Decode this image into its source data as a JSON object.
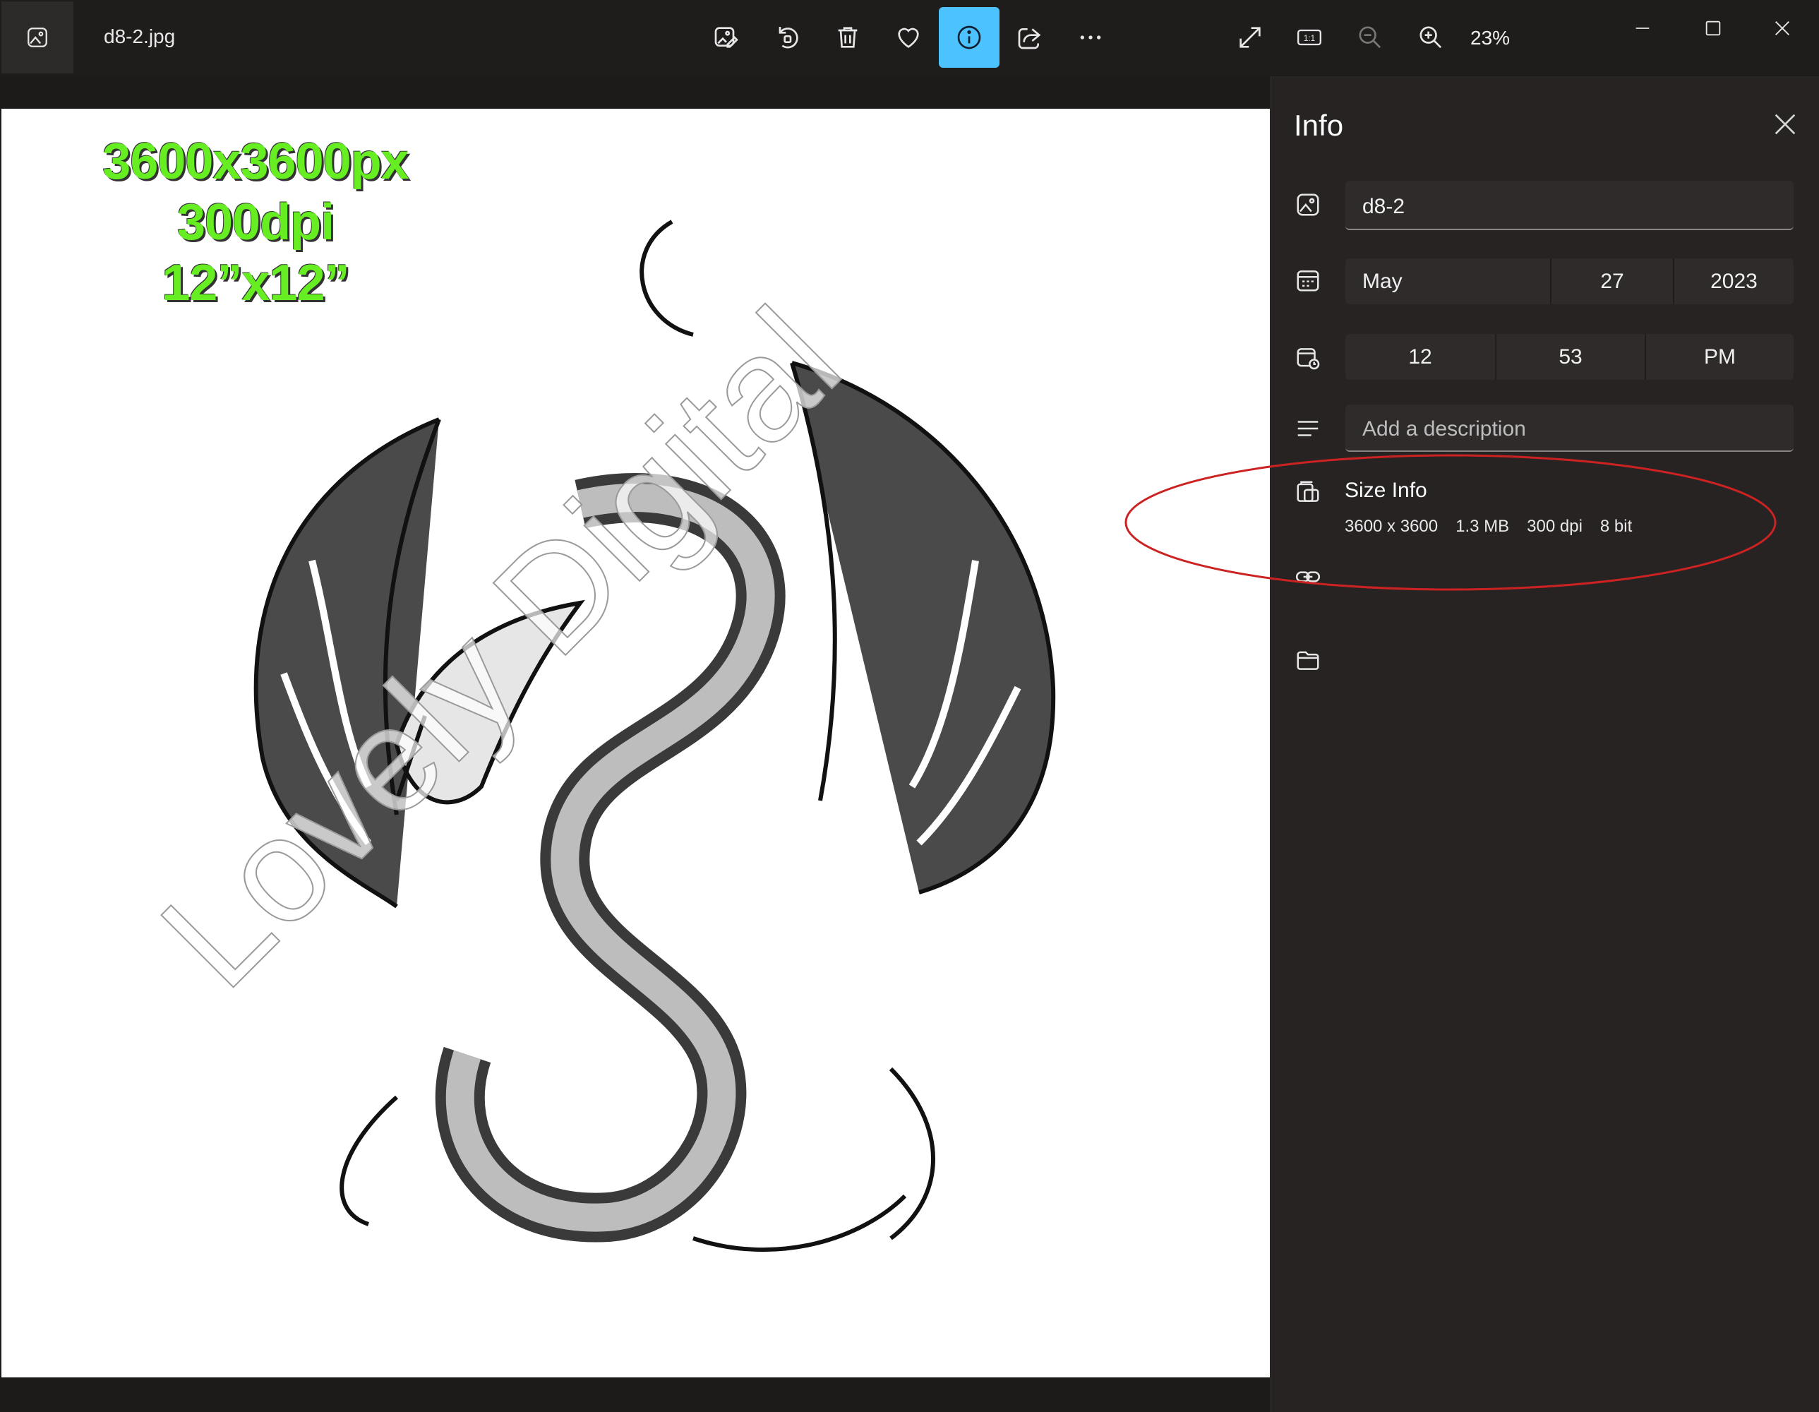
{
  "titlebar": {
    "file_name": "d8-2.jpg",
    "zoom_level": "23%",
    "toolbar_icons": [
      "edit-image-icon",
      "rotate-icon",
      "delete-icon",
      "favorite-icon",
      "info-icon",
      "share-icon",
      "more-icon"
    ],
    "view_icons": [
      "fullscreen-icon",
      "actual-size-icon",
      "zoom-out-icon",
      "zoom-in-icon"
    ],
    "window_icons": [
      "minimize-icon",
      "maximize-icon",
      "close-icon"
    ]
  },
  "image": {
    "spec_lines": [
      "3600x3600px",
      "300dpi",
      "12”x12”"
    ],
    "watermark_text": "Lovely Digital",
    "spec_color": "#66ee22"
  },
  "info_panel": {
    "title": "Info",
    "name_value": "d8-2",
    "date": {
      "month": "May",
      "day": "27",
      "year": "2023"
    },
    "time": {
      "hour": "12",
      "minute": "53",
      "period": "PM"
    },
    "description_placeholder": "Add a description",
    "size_info": {
      "title": "Size Info",
      "dimensions": "3600 x 3600",
      "file_size": "1.3 MB",
      "dpi": "300 dpi",
      "bit_depth": "8 bit"
    }
  },
  "colors": {
    "accent": "#4cc2ff",
    "panel_bg": "#272323",
    "annotation": "#cc2222"
  }
}
